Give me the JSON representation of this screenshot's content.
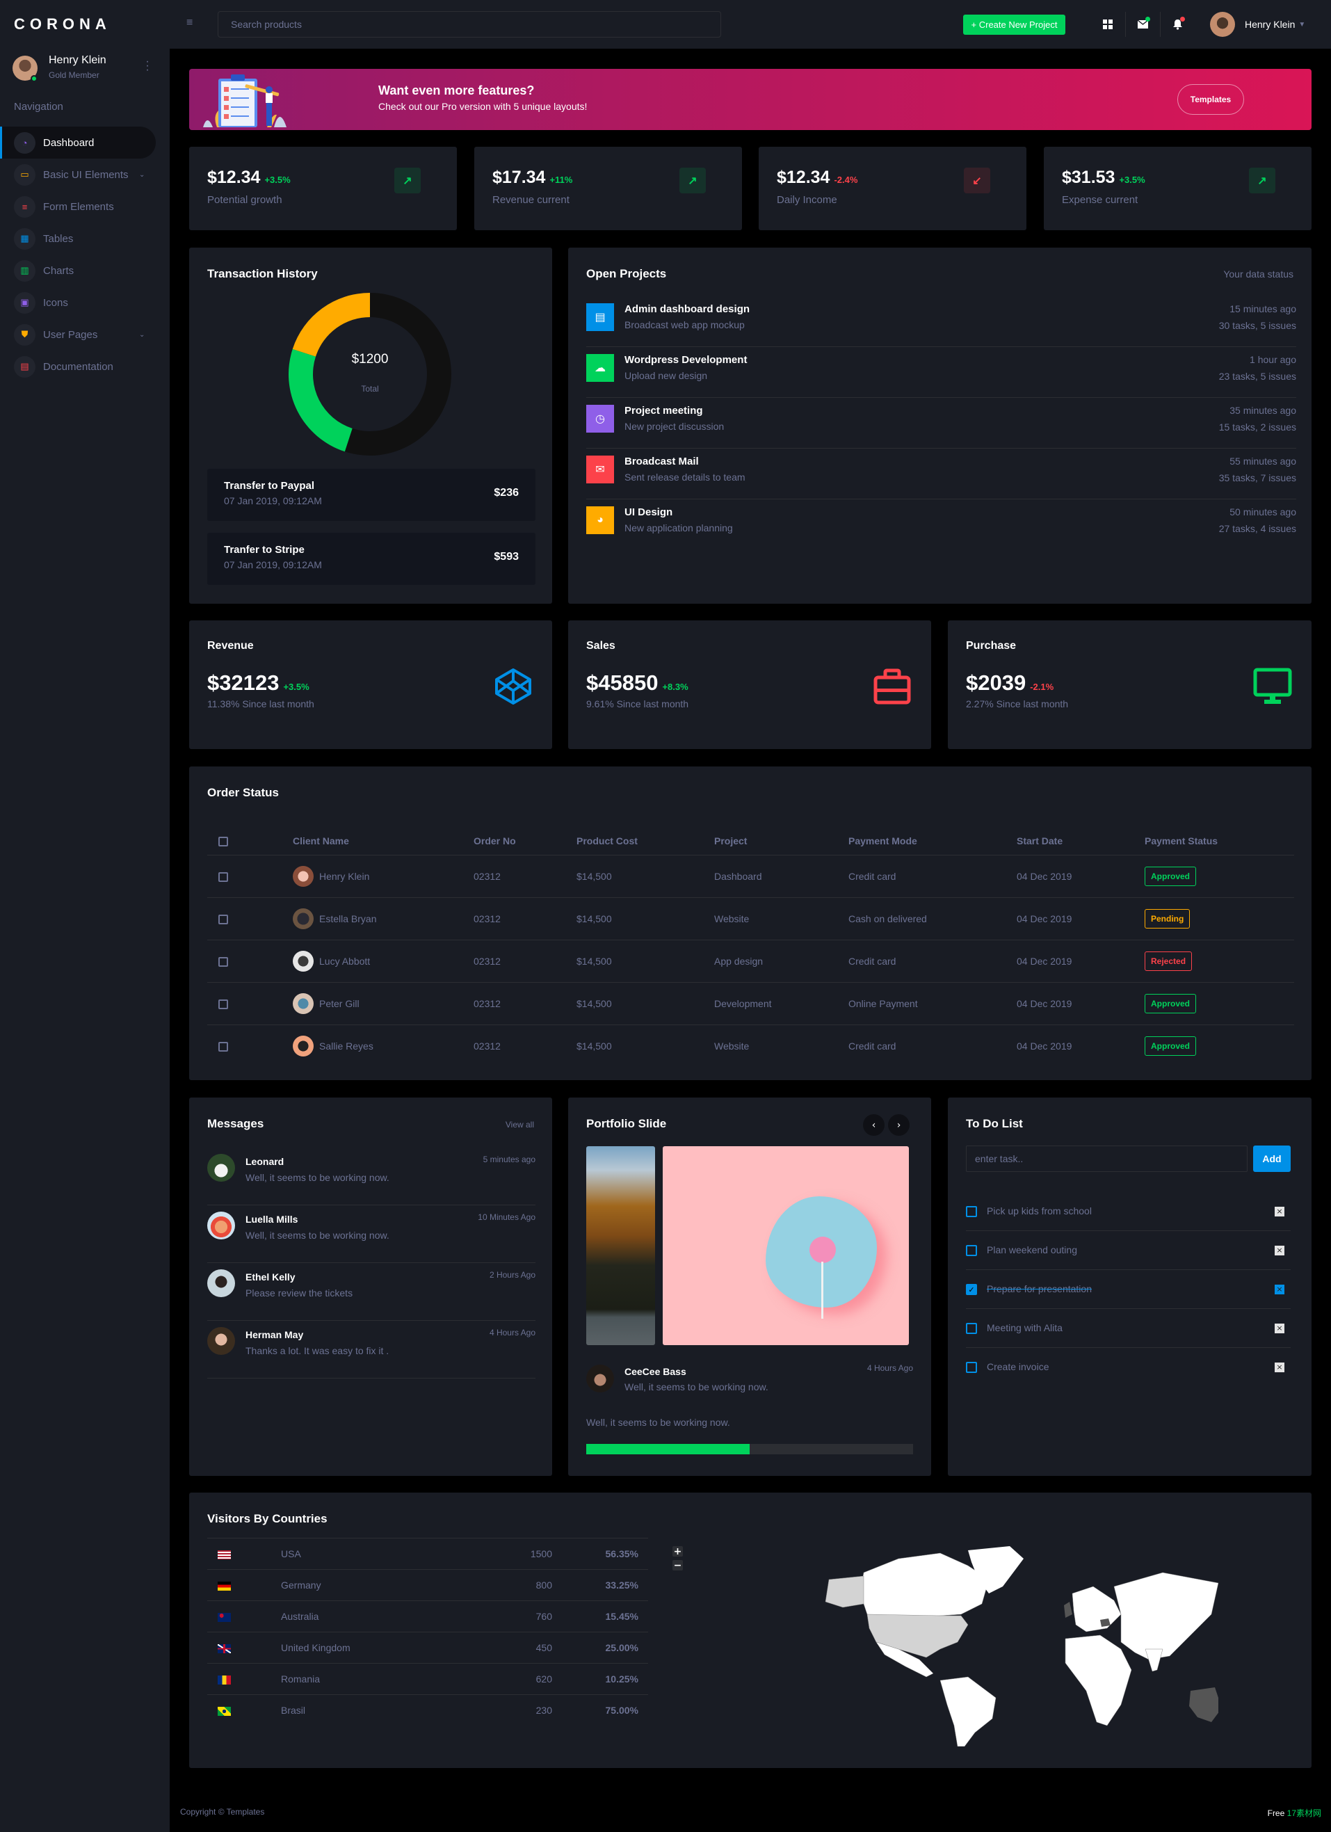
{
  "app": {
    "brand": "CORONA"
  },
  "sidebar": {
    "user": {
      "name": "Henry Klein",
      "role": "Gold Member"
    },
    "heading": "Navigation",
    "items": [
      {
        "label": "Dashboard",
        "icon": "speedometer-icon",
        "color": "#8f5fe8",
        "active": true,
        "expandable": false
      },
      {
        "label": "Basic UI Elements",
        "icon": "laptop-icon",
        "color": "#ffab00",
        "active": false,
        "expandable": true
      },
      {
        "label": "Form Elements",
        "icon": "form-list-icon",
        "color": "#fc424a",
        "active": false,
        "expandable": false
      },
      {
        "label": "Tables",
        "icon": "table-icon",
        "color": "#0090e7",
        "active": false,
        "expandable": false
      },
      {
        "label": "Charts",
        "icon": "bar-chart-icon",
        "color": "#00d25b",
        "active": false,
        "expandable": false
      },
      {
        "label": "Icons",
        "icon": "contacts-icon",
        "color": "#8f5fe8",
        "active": false,
        "expandable": false
      },
      {
        "label": "User Pages",
        "icon": "security-shield-icon",
        "color": "#ffab00",
        "active": false,
        "expandable": true
      },
      {
        "label": "Documentation",
        "icon": "document-icon",
        "color": "#fc424a",
        "active": false,
        "expandable": false
      }
    ]
  },
  "topbar": {
    "search_placeholder": "Search products",
    "create_label": "+ Create New Project",
    "user_name": "Henry Klein",
    "mail_badge_color": "#00d25b",
    "bell_badge_color": "#fc424a"
  },
  "banner": {
    "title": "Want even more features?",
    "subtitle": "Check out our Pro version with 5 unique layouts!",
    "button": "Templates"
  },
  "stats": [
    {
      "value": "$12.34",
      "delta": "+3.5%",
      "trend": "up",
      "label": "Potential growth"
    },
    {
      "value": "$17.34",
      "delta": "+11%",
      "trend": "up",
      "label": "Revenue current"
    },
    {
      "value": "$12.34",
      "delta": "-2.4%",
      "trend": "down",
      "label": "Daily Income"
    },
    {
      "value": "$31.53",
      "delta": "+3.5%",
      "trend": "up",
      "label": "Expense current"
    }
  ],
  "transaction_history": {
    "title": "Transaction History",
    "total": "$1200",
    "total_label": "Total",
    "chart_data": {
      "type": "pie",
      "segments": [
        {
          "name": "segment-black",
          "value": 55,
          "color": "#111111"
        },
        {
          "name": "segment-green",
          "value": 25,
          "color": "#00d25b"
        },
        {
          "name": "segment-orange",
          "value": 20,
          "color": "#ffab00"
        }
      ]
    },
    "transactions": [
      {
        "name": "Transfer to Paypal",
        "date": "07 Jan 2019, 09:12AM",
        "amount": "$236"
      },
      {
        "name": "Tranfer to Stripe",
        "date": "07 Jan 2019, 09:12AM",
        "amount": "$593"
      }
    ]
  },
  "open_projects": {
    "title": "Open Projects",
    "status_label": "Your data status",
    "items": [
      {
        "title": "Admin dashboard design",
        "subtitle": "Broadcast web app mockup",
        "time": "15 minutes ago",
        "tasks": "30 tasks, 5 issues",
        "icon": "file-icon",
        "color": "#0090e7"
      },
      {
        "title": "Wordpress Development",
        "subtitle": "Upload new design",
        "time": "1 hour ago",
        "tasks": "23 tasks, 5 issues",
        "icon": "cloud-download-icon",
        "color": "#00d25b"
      },
      {
        "title": "Project meeting",
        "subtitle": "New project discussion",
        "time": "35 minutes ago",
        "tasks": "15 tasks, 2 issues",
        "icon": "clock-icon",
        "color": "#8f5fe8"
      },
      {
        "title": "Broadcast Mail",
        "subtitle": "Sent release details to team",
        "time": "55 minutes ago",
        "tasks": "35 tasks, 7 issues",
        "icon": "mail-icon",
        "color": "#fc424a"
      },
      {
        "title": "UI Design",
        "subtitle": "New application planning",
        "time": "50 minutes ago",
        "tasks": "27 tasks, 4 issues",
        "icon": "chart-pie-icon",
        "color": "#ffab00"
      }
    ]
  },
  "metrics": [
    {
      "title": "Revenue",
      "value": "$32123",
      "delta": "+3.5%",
      "trend": "up",
      "sub": "11.38% Since last month",
      "icon": "codepen-icon",
      "color": "#0090e7"
    },
    {
      "title": "Sales",
      "value": "$45850",
      "delta": "+8.3%",
      "trend": "up",
      "sub": "9.61% Since last month",
      "icon": "briefcase-icon",
      "color": "#fc424a"
    },
    {
      "title": "Purchase",
      "value": "$2039",
      "delta": "-2.1%",
      "trend": "down",
      "sub": "2.27% Since last month",
      "icon": "monitor-icon",
      "color": "#00d25b"
    }
  ],
  "order_status": {
    "title": "Order Status",
    "columns": [
      "",
      "Client Name",
      "Order No",
      "Product Cost",
      "Project",
      "Payment Mode",
      "Start Date",
      "Payment Status"
    ],
    "rows": [
      {
        "client": "Henry Klein",
        "order": "02312",
        "cost": "$14,500",
        "project": "Dashboard",
        "mode": "Credit card",
        "date": "04 Dec 2019",
        "status": "Approved",
        "status_type": "approved"
      },
      {
        "client": "Estella Bryan",
        "order": "02312",
        "cost": "$14,500",
        "project": "Website",
        "mode": "Cash on delivered",
        "date": "04 Dec 2019",
        "status": "Pending",
        "status_type": "pending"
      },
      {
        "client": "Lucy Abbott",
        "order": "02312",
        "cost": "$14,500",
        "project": "App design",
        "mode": "Credit card",
        "date": "04 Dec 2019",
        "status": "Rejected",
        "status_type": "rejected"
      },
      {
        "client": "Peter Gill",
        "order": "02312",
        "cost": "$14,500",
        "project": "Development",
        "mode": "Online Payment",
        "date": "04 Dec 2019",
        "status": "Approved",
        "status_type": "approved"
      },
      {
        "client": "Sallie Reyes",
        "order": "02312",
        "cost": "$14,500",
        "project": "Website",
        "mode": "Credit card",
        "date": "04 Dec 2019",
        "status": "Approved",
        "status_type": "approved"
      }
    ]
  },
  "messages": {
    "title": "Messages",
    "view_all": "View all",
    "items": [
      {
        "name": "Leonard",
        "text": "Well, it seems to be working now.",
        "time": "5 minutes ago"
      },
      {
        "name": "Luella Mills",
        "text": "Well, it seems to be working now.",
        "time": "10 Minutes Ago"
      },
      {
        "name": "Ethel Kelly",
        "text": "Please review the tickets",
        "time": "2 Hours Ago"
      },
      {
        "name": "Herman May",
        "text": "Thanks a lot. It was easy to fix it .",
        "time": "4 Hours Ago"
      }
    ]
  },
  "portfolio": {
    "title": "Portfolio Slide",
    "author": "CeeCee Bass",
    "author_text": "Well, it seems to be working now.",
    "time": "4 Hours Ago",
    "caption": "Well, it seems to be working now.",
    "progress_percent": 50
  },
  "todo": {
    "title": "To Do List",
    "placeholder": "enter task..",
    "add_label": "Add",
    "items": [
      {
        "label": "Pick up kids from school",
        "done": false
      },
      {
        "label": "Plan weekend outing",
        "done": false
      },
      {
        "label": "Prepare for presentation",
        "done": true
      },
      {
        "label": "Meeting with Alita",
        "done": false
      },
      {
        "label": "Create invoice",
        "done": false
      }
    ]
  },
  "visitors": {
    "title": "Visitors By Countries",
    "rows": [
      {
        "country": "USA",
        "flag": "us-flag-icon",
        "visits": "1500",
        "percent": "56.35%"
      },
      {
        "country": "Germany",
        "flag": "de-flag-icon",
        "visits": "800",
        "percent": "33.25%"
      },
      {
        "country": "Australia",
        "flag": "au-flag-icon",
        "visits": "760",
        "percent": "15.45%"
      },
      {
        "country": "United Kingdom",
        "flag": "gb-flag-icon",
        "visits": "450",
        "percent": "25.00%"
      },
      {
        "country": "Romania",
        "flag": "ro-flag-icon",
        "visits": "620",
        "percent": "10.25%"
      },
      {
        "country": "Brasil",
        "flag": "br-flag-icon",
        "visits": "230",
        "percent": "75.00%"
      }
    ],
    "zoom_in": "+",
    "zoom_out": "−"
  },
  "footer": {
    "copyright": "Copyright © Templates",
    "right_prefix": "Free",
    "right_brand": "17素材网"
  }
}
